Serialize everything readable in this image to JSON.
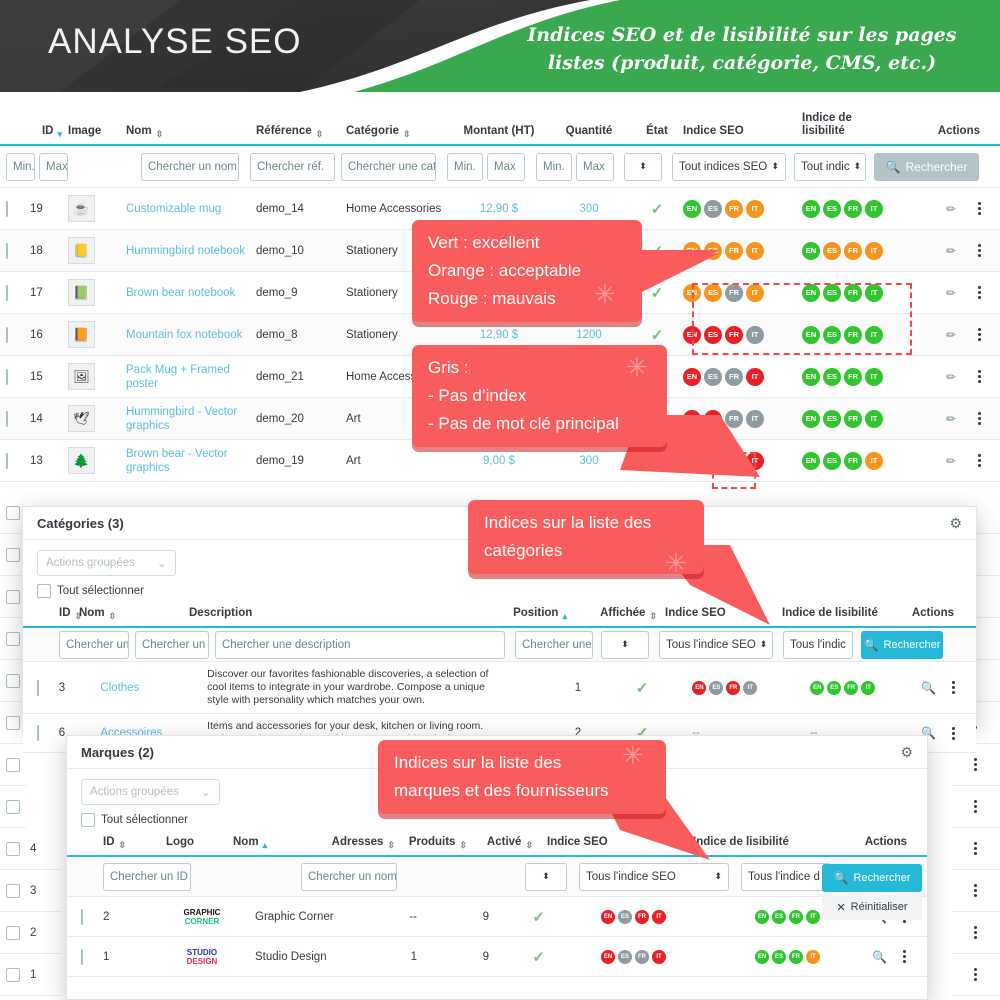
{
  "banner": {
    "title": "ANALYSE SEO",
    "subtitle_line1": "Indices SEO et de lisibilité sur les pages",
    "subtitle_line2": "listes (produit, catégorie, CMS, etc.)",
    "bg_dark": "#343434",
    "bg_green": "#3aa84f"
  },
  "colors": {
    "good": "#31c52f",
    "acceptable": "#f7941e",
    "bad": "#ea2027",
    "none": "#8f9ba1",
    "accent": "#25b9d7",
    "callout": "#f85c5c",
    "link": "#5bc0de"
  },
  "products": {
    "columns": [
      {
        "label": "ID",
        "sort": "down"
      },
      {
        "label": "Image",
        "sort": ""
      },
      {
        "label": "Nom",
        "sort": "both"
      },
      {
        "label": "Référence",
        "sort": "both"
      },
      {
        "label": "Catégorie",
        "sort": "both"
      },
      {
        "label": "Montant (HT)",
        "sort": ""
      },
      {
        "label": "Quantité",
        "sort": ""
      },
      {
        "label": "État",
        "sort": ""
      },
      {
        "label": "Indice SEO",
        "sort": ""
      },
      {
        "label": "Indice de lisibilité",
        "sort": ""
      },
      {
        "label": "Actions",
        "sort": ""
      }
    ],
    "filters": {
      "id_min": "Min.",
      "id_max": "Max",
      "name": "Chercher un nom",
      "reference": "Chercher réf.",
      "category": "Chercher une cat",
      "price_min": "Min.",
      "price_max": "Max",
      "qty_min": "Min.",
      "qty_max": "Max",
      "state": "",
      "seo_index": "Tout indices SEO",
      "readability_index": "Tout indic",
      "search_button": "Rechercher"
    },
    "rows": [
      {
        "id": "19",
        "name": "Customizable mug",
        "reference": "demo_14",
        "category": "Home Accessories",
        "price": "12,90 $",
        "qty": "300",
        "state": "check",
        "thumb": "☕",
        "seo": [
          "g",
          "x",
          "o",
          "o"
        ],
        "read": [
          "g",
          "g",
          "g",
          "g"
        ]
      },
      {
        "id": "18",
        "name": "Hummingbird notebook",
        "reference": "demo_10",
        "category": "Stationery",
        "price": "",
        "qty": "",
        "state": "check",
        "thumb": "📒",
        "seo": [
          "o",
          "o",
          "o",
          "o"
        ],
        "read": [
          "g",
          "o",
          "o",
          "o"
        ]
      },
      {
        "id": "17",
        "name": "Brown bear notebook",
        "reference": "demo_9",
        "category": "Stationery",
        "price": "",
        "qty": "",
        "state": "check",
        "thumb": "📗",
        "seo": [
          "o",
          "o",
          "x",
          "o"
        ],
        "read": [
          "g",
          "g",
          "g",
          "g"
        ]
      },
      {
        "id": "16",
        "name": "Mountain fox notebook",
        "reference": "demo_8",
        "category": "Stationery",
        "price": "12,90 $",
        "qty": "1200",
        "state": "check",
        "thumb": "📙",
        "seo": [
          "r",
          "r",
          "r",
          "x"
        ],
        "read": [
          "g",
          "g",
          "g",
          "g"
        ]
      },
      {
        "id": "15",
        "name": "Pack Mug + Framed poster",
        "reference": "demo_21",
        "category": "Home Accessories",
        "price": "",
        "qty": "",
        "state": "check",
        "thumb": "🖼",
        "seo": [
          "r",
          "x",
          "x",
          "r"
        ],
        "read": [
          "g",
          "g",
          "g",
          "g"
        ]
      },
      {
        "id": "14",
        "name": "Hummingbird - Vector graphics",
        "reference": "demo_20",
        "category": "Art",
        "price": "",
        "qty": "",
        "state": "check",
        "thumb": "🕊",
        "seo": [
          "r",
          "r",
          "x",
          "x"
        ],
        "read": [
          "g",
          "g",
          "g",
          "g"
        ]
      },
      {
        "id": "13",
        "name": "Brown bear - Vector graphics",
        "reference": "demo_19",
        "category": "Art",
        "price": "9,00 $",
        "qty": "300",
        "state": "check",
        "thumb": "🌲",
        "seo": [
          "r",
          "x",
          "x",
          "r"
        ],
        "read": [
          "g",
          "g",
          "g",
          "o"
        ]
      }
    ],
    "background_ids": [
      "4",
      "3",
      "2",
      "1"
    ]
  },
  "categories": {
    "title": "Catégories (3)",
    "bulk_actions": "Actions groupées",
    "select_all": "Tout sélectionner",
    "columns": [
      {
        "label": "ID",
        "sort": "both"
      },
      {
        "label": "Nom",
        "sort": "both"
      },
      {
        "label": "Description",
        "sort": ""
      },
      {
        "label": "Position",
        "sort": "asc"
      },
      {
        "label": "Affichée",
        "sort": "both"
      },
      {
        "label": "Indice SEO",
        "sort": ""
      },
      {
        "label": "Indice de lisibilité",
        "sort": ""
      },
      {
        "label": "Actions",
        "sort": ""
      }
    ],
    "filters": {
      "id": "Chercher un I",
      "name": "Chercher un no",
      "description": "Chercher une description",
      "position": "Chercher une pos",
      "displayed": "",
      "seo_index": "Tous l'indice SEO",
      "readability_index": "Tous l'indic",
      "search_button": "Rechercher"
    },
    "rows": [
      {
        "id": "3",
        "name": "Clothes",
        "description": "Discover our favorites fashionable discoveries, a selection of cool items to integrate in your wardrobe. Compose a unique style with personality which matches your own.",
        "position": "1",
        "displayed": "check",
        "seo": [
          "r",
          "x",
          "r",
          "x"
        ],
        "read": [
          "g",
          "g",
          "g",
          "g"
        ]
      },
      {
        "id": "6",
        "name": "Accessoires",
        "description": "Items and accessories for your desk, kitchen or living room. Make your house a home with our eye-catching designs.",
        "position": "2",
        "displayed": "check",
        "seo": "--",
        "read": "--"
      }
    ]
  },
  "brands": {
    "title": "Marques (2)",
    "bulk_actions": "Actions groupées",
    "select_all": "Tout sélectionner",
    "columns": [
      {
        "label": "ID",
        "sort": "both"
      },
      {
        "label": "Logo",
        "sort": ""
      },
      {
        "label": "Nom",
        "sort": "asc"
      },
      {
        "label": "Adresses",
        "sort": "both"
      },
      {
        "label": "Produits",
        "sort": "both"
      },
      {
        "label": "Activé",
        "sort": "both"
      },
      {
        "label": "Indice SEO",
        "sort": ""
      },
      {
        "label": "Indice de lisibilité",
        "sort": ""
      },
      {
        "label": "Actions",
        "sort": ""
      }
    ],
    "filters": {
      "id": "Chercher un ID",
      "name": "Chercher un nom",
      "enabled": "",
      "seo_index": "Tous l'indice SEO",
      "readability_index": "Tous l'indice d",
      "search_button": "Rechercher",
      "reset_button": "Réinitialiser"
    },
    "rows": [
      {
        "id": "2",
        "logo_line1": "GRAPHIC",
        "logo_line2": "CORNER",
        "name": "Graphic Corner",
        "addresses": "--",
        "products": "9",
        "enabled": "check",
        "seo": [
          "r",
          "x",
          "r",
          "r"
        ],
        "read": [
          "g",
          "g",
          "g",
          "g"
        ]
      },
      {
        "id": "1",
        "logo_line1": "STUDIO",
        "logo_line2": "DESIGN",
        "name": "Studio Design",
        "addresses": "1",
        "products": "9",
        "enabled": "check",
        "seo": [
          "r",
          "x",
          "x",
          "r"
        ],
        "read": [
          "g",
          "g",
          "g",
          "o"
        ]
      }
    ]
  },
  "locales": [
    "EN",
    "ES",
    "FR",
    "IT"
  ],
  "callouts": [
    {
      "id": "legend-colors",
      "lines": [
        "Vert : excellent",
        "Orange : acceptable",
        "Rouge : mauvais"
      ]
    },
    {
      "id": "legend-grey",
      "lines": [
        "Gris :",
        "- Pas d’index",
        "- Pas de mot clé principal"
      ]
    },
    {
      "id": "categories-note",
      "lines": [
        "Indices sur la liste des",
        "catégories"
      ]
    },
    {
      "id": "brands-note",
      "lines": [
        "Indices sur la liste des",
        "marques et des fournisseurs"
      ]
    }
  ]
}
